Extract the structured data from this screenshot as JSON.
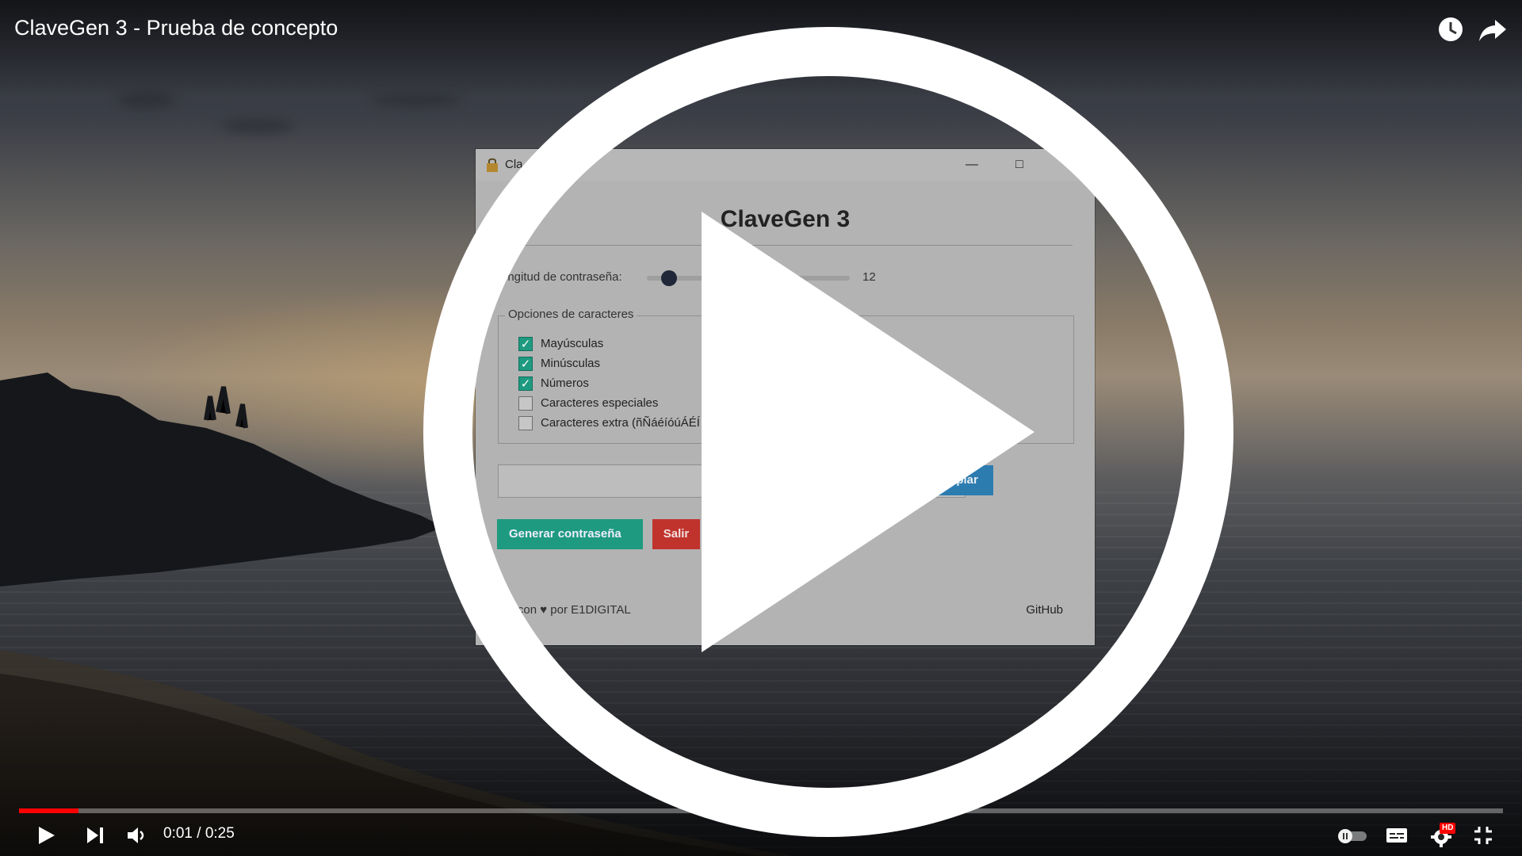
{
  "video": {
    "title": "ClaveGen 3 - Prueba de concepto",
    "time_current": "0:01",
    "time_separator": "/",
    "time_total": "0:25",
    "progress_fraction": 0.04,
    "hd_badge": "HD"
  },
  "app": {
    "window_title": "Cla",
    "heading": "ClaveGen 3",
    "length_label": "ongitud de contraseña:",
    "length_value": "12",
    "options_legend": "Opciones de caracteres",
    "options": [
      {
        "label": "Mayúsculas",
        "checked": true
      },
      {
        "label": "Minúsculas",
        "checked": true
      },
      {
        "label": "Números",
        "checked": true
      },
      {
        "label": "Caracteres especiales",
        "checked": false
      },
      {
        "label": "Caracteres extra (ñÑáéíóúÁÉÍ",
        "checked": false
      }
    ],
    "copy_label": "opiar",
    "generate_label": "Generar contraseña",
    "exit_label": "Salir",
    "footer_credit": "ho con ♥ por E1DIGITAL",
    "footer_link": "GitHub",
    "checkmark": "✓"
  },
  "icons": {
    "clock": "clock-icon",
    "share": "share-icon",
    "play": "play-icon",
    "next": "next-icon",
    "volume": "volume-icon",
    "autoplay": "autoplay-toggle-icon",
    "subtitles": "subtitles-icon",
    "settings": "settings-icon",
    "exit_fullscreen": "exit-fullscreen-icon"
  },
  "colors": {
    "progress": "#ff0000",
    "teal": "#1e9a80",
    "red_button": "#c0332c",
    "blue_button": "#2c7cb0"
  }
}
